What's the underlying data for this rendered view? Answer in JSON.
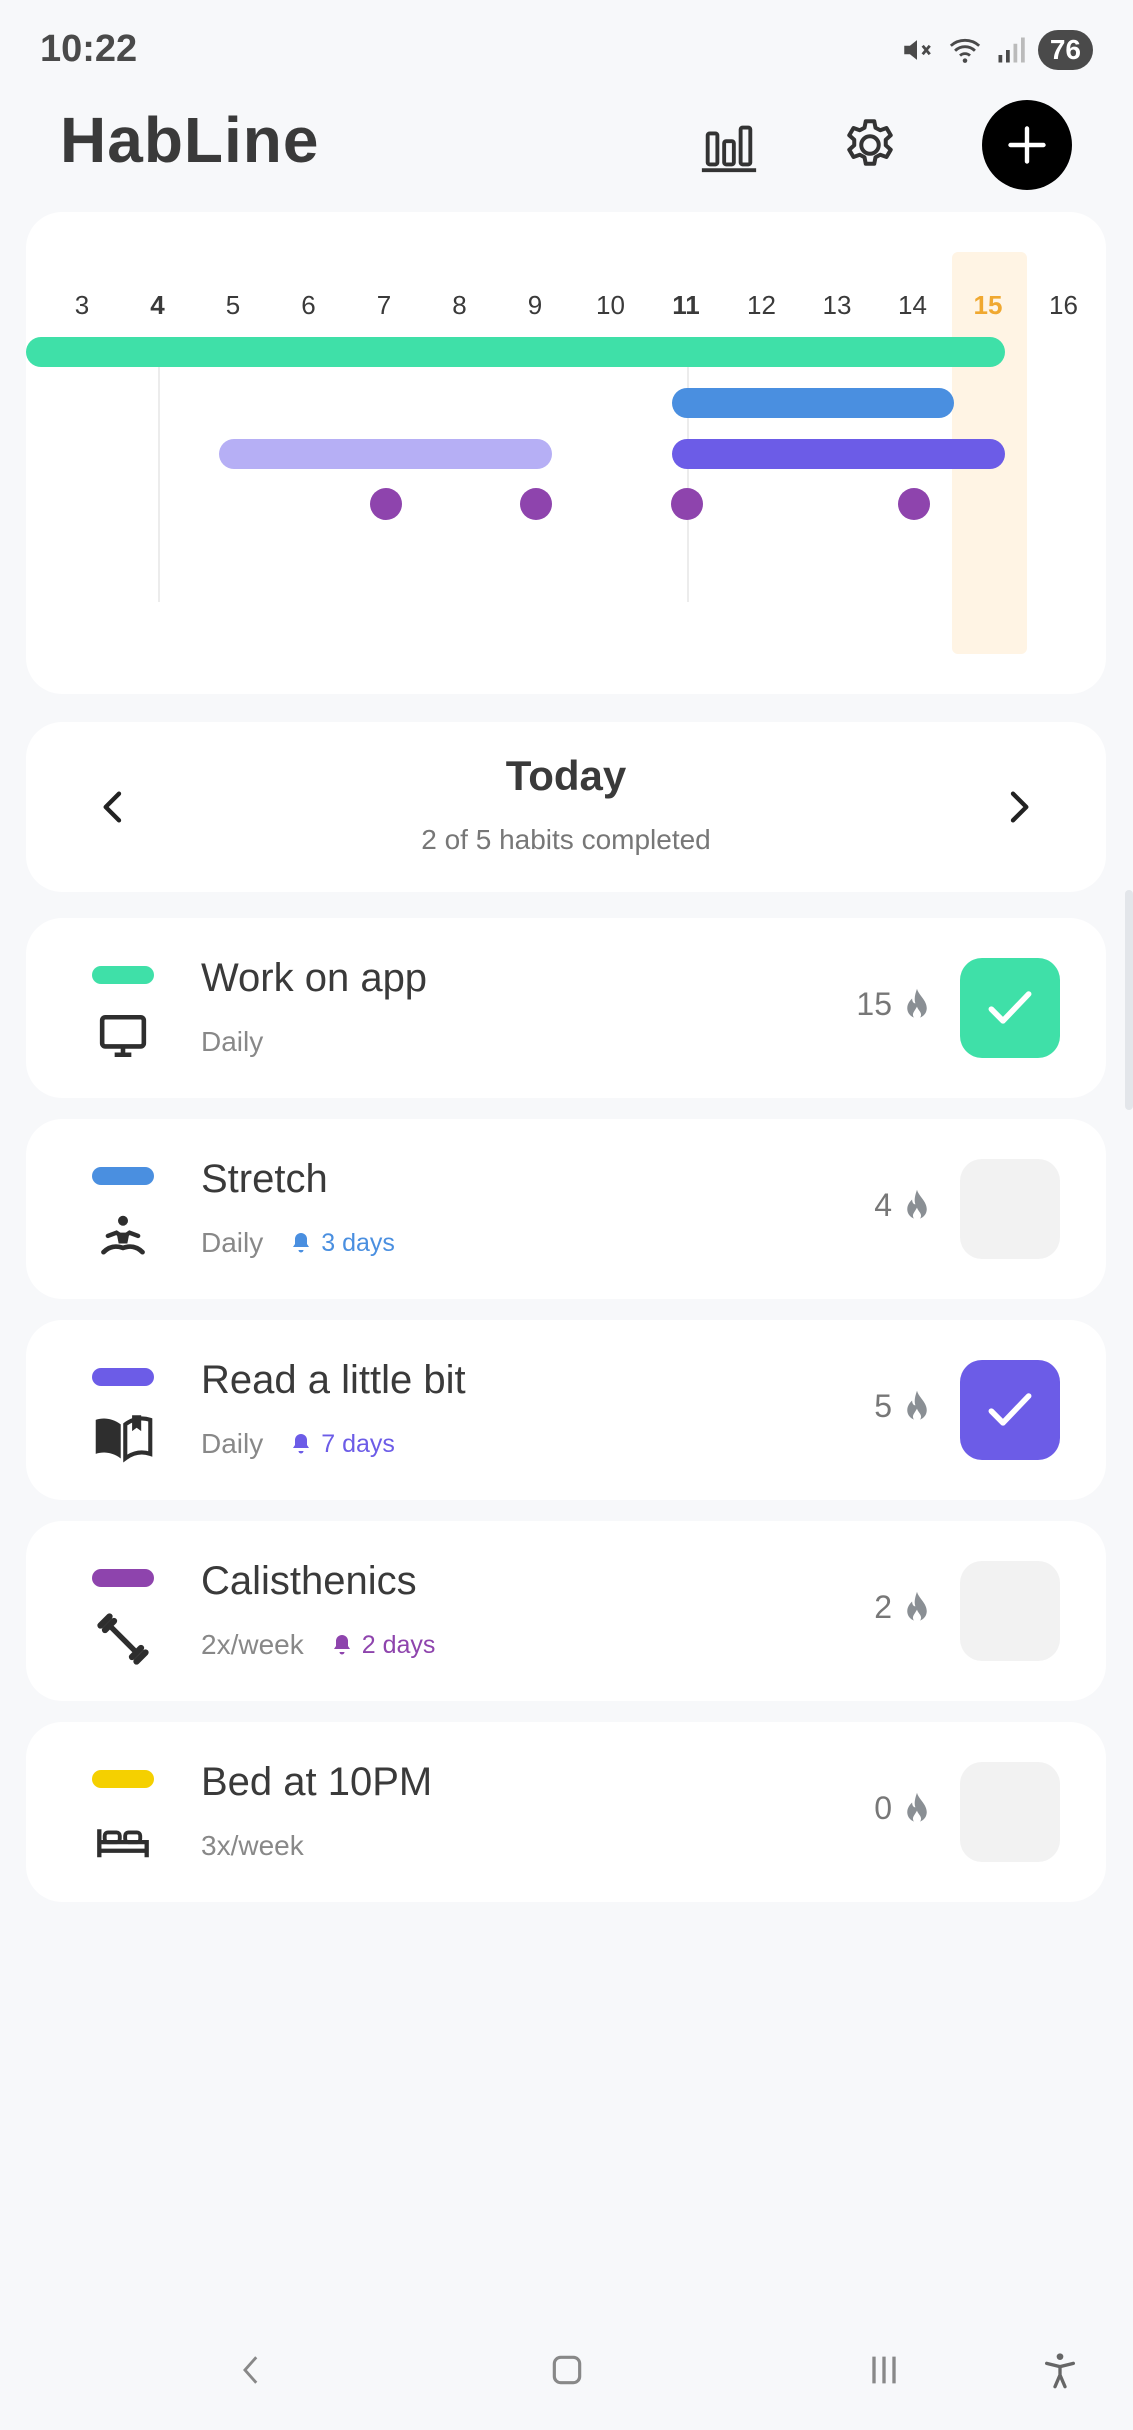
{
  "status_bar": {
    "time": "10:22",
    "battery": "76"
  },
  "app": {
    "title": "HabLine"
  },
  "timeline": {
    "days": [
      "3",
      "4",
      "5",
      "6",
      "7",
      "8",
      "9",
      "10",
      "11",
      "12",
      "13",
      "14",
      "15",
      "16"
    ],
    "bold_days": [
      "4",
      "11"
    ],
    "today": "15"
  },
  "today_nav": {
    "title": "Today",
    "subtitle": "2 of 5 habits completed"
  },
  "habits": [
    {
      "name": "Work on app",
      "frequency": "Daily",
      "reminder": "",
      "streak": "15",
      "color": "#3fe0a8",
      "icon": "monitor-icon",
      "completed": true
    },
    {
      "name": "Stretch",
      "frequency": "Daily",
      "reminder": "3 days",
      "streak": "4",
      "color": "#4a8fe0",
      "icon": "meditation-icon",
      "completed": false
    },
    {
      "name": "Read a little bit",
      "frequency": "Daily",
      "reminder": "7 days",
      "streak": "5",
      "color": "#6c5ce7",
      "icon": "book-icon",
      "completed": true
    },
    {
      "name": "Calisthenics",
      "frequency": "2x/week",
      "reminder": "2 days",
      "streak": "2",
      "color": "#8e44ad",
      "icon": "dumbbell-icon",
      "completed": false
    },
    {
      "name": "Bed at 10PM",
      "frequency": "3x/week",
      "reminder": "",
      "streak": "0",
      "color": "#f5d000",
      "icon": "bed-icon",
      "completed": false
    }
  ],
  "colors": {
    "accent_today": "#f0a830",
    "check_green": "#3fe0a8",
    "check_purple": "#6c5ce7"
  }
}
